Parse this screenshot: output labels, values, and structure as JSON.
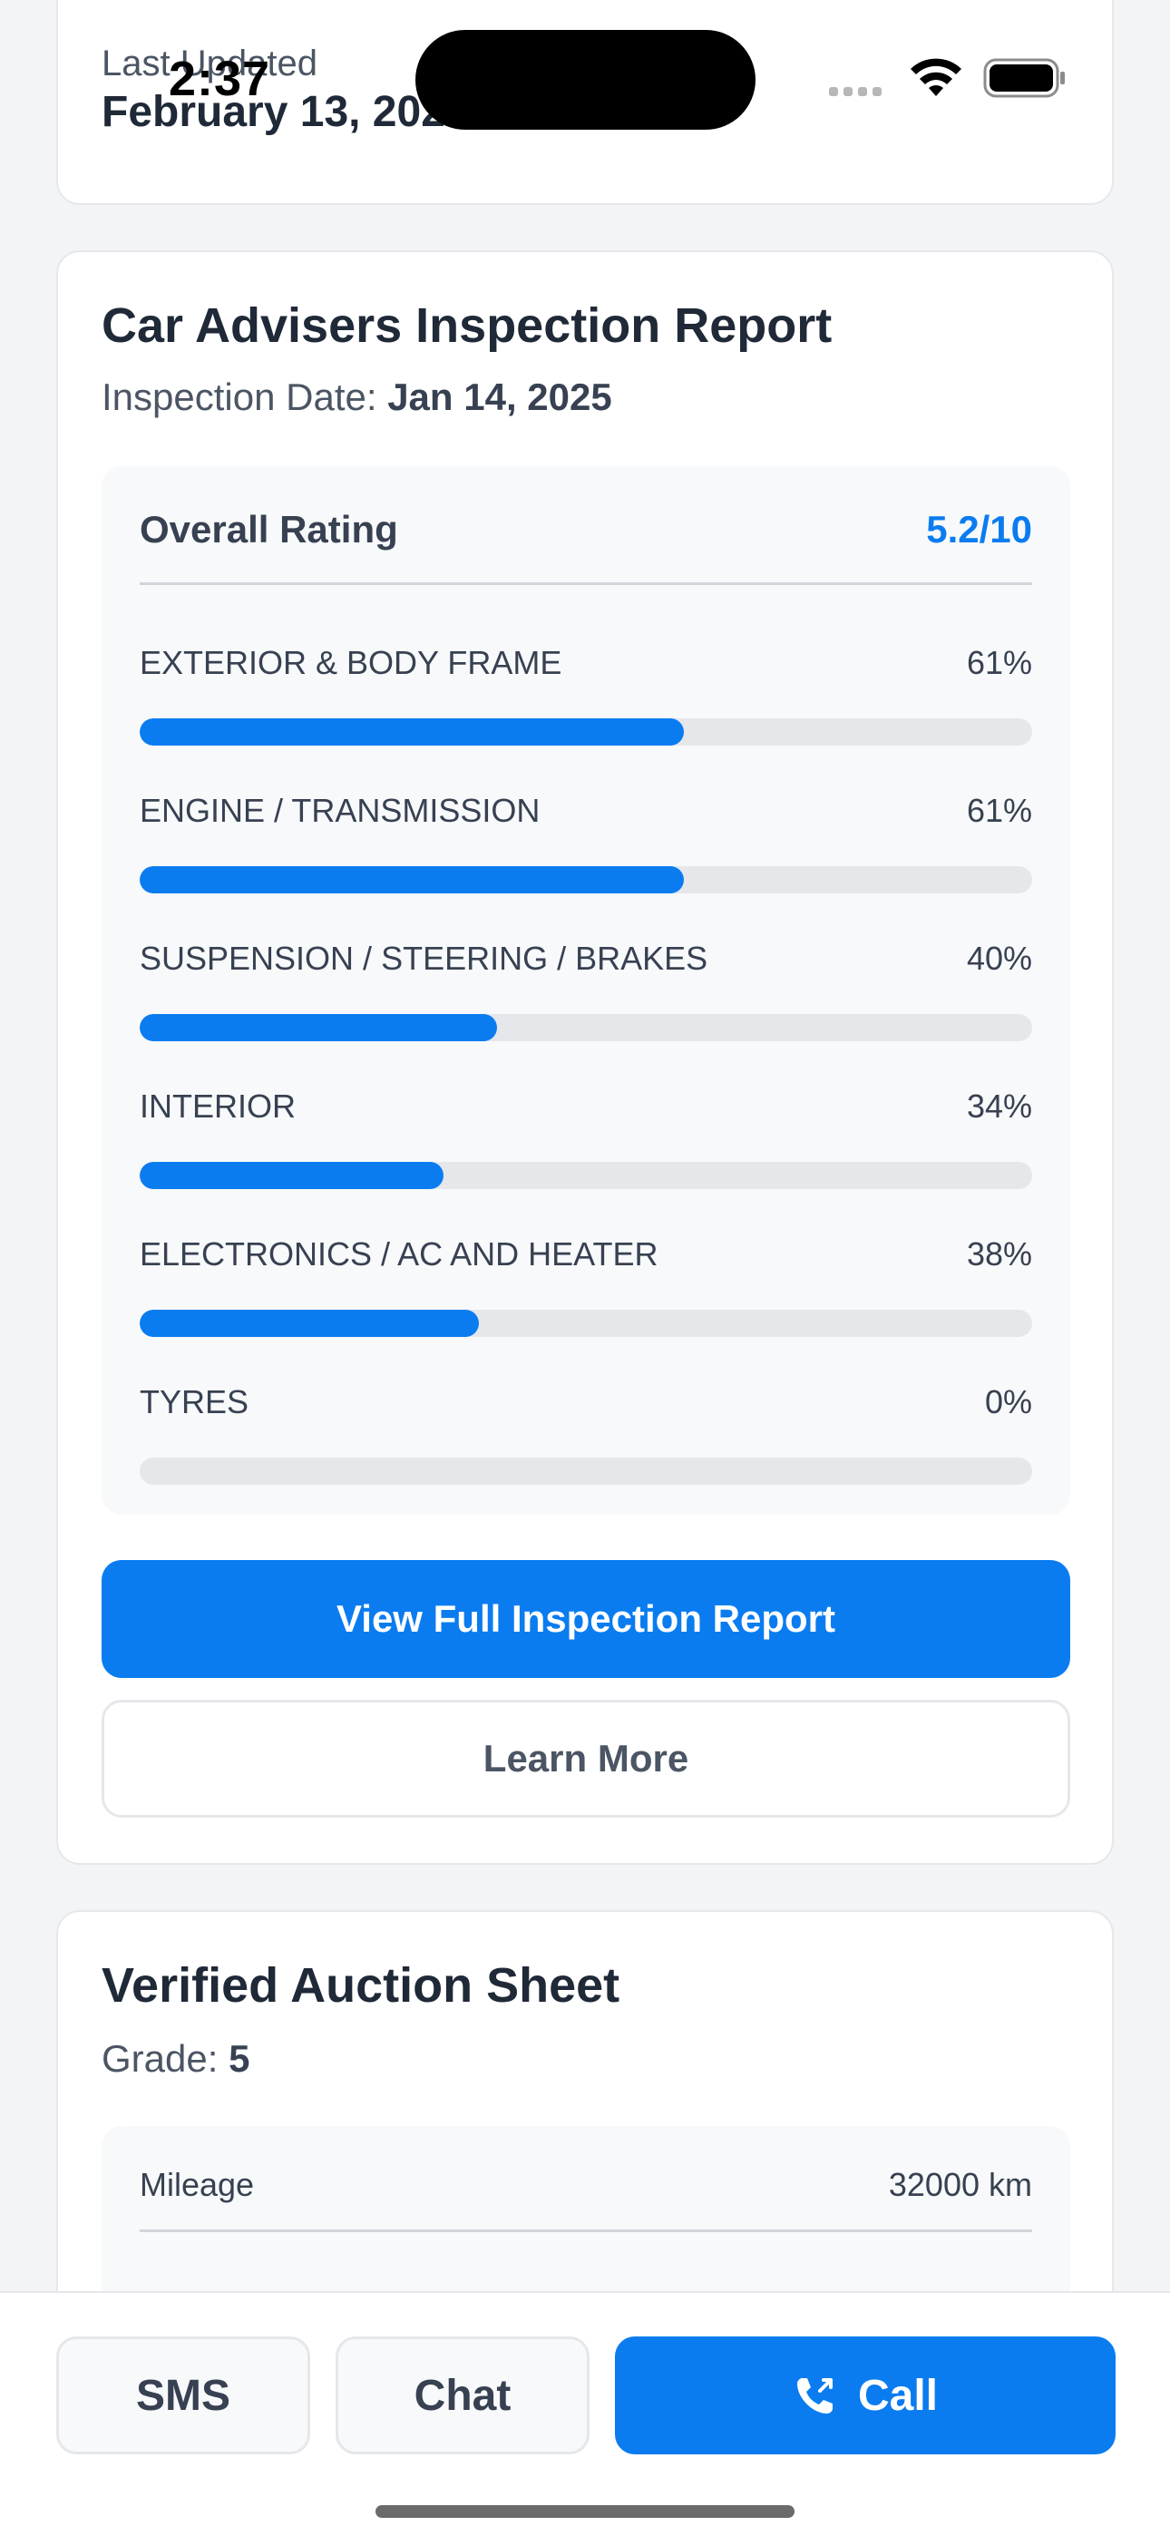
{
  "status_bar": {
    "time": "2:37"
  },
  "last_updated": {
    "label": "Last Updated",
    "date": "February 13, 2025"
  },
  "inspection": {
    "title": "Car Advisers Inspection Report",
    "date_label": "Inspection Date:",
    "date_value": "Jan 14, 2025",
    "overall_label": "Overall Rating",
    "overall_value": "5.2/10",
    "categories": [
      {
        "name": "EXTERIOR & BODY FRAME",
        "percent_label": "61%",
        "percent": 61
      },
      {
        "name": "ENGINE / TRANSMISSION",
        "percent_label": "61%",
        "percent": 61
      },
      {
        "name": "SUSPENSION / STEERING / BRAKES",
        "percent_label": "40%",
        "percent": 40
      },
      {
        "name": "INTERIOR",
        "percent_label": "34%",
        "percent": 34
      },
      {
        "name": "ELECTRONICS / AC AND HEATER",
        "percent_label": "38%",
        "percent": 38
      },
      {
        "name": "TYRES",
        "percent_label": "0%",
        "percent": 0
      }
    ],
    "view_report_label": "View Full Inspection Report",
    "learn_more_label": "Learn More"
  },
  "auction": {
    "title": "Verified Auction Sheet",
    "grade_label": "Grade:",
    "grade_value": "5",
    "rows": [
      {
        "label": "Mileage",
        "value": "32000 km"
      }
    ]
  },
  "actions": {
    "sms_label": "SMS",
    "chat_label": "Chat",
    "call_label": "Call"
  },
  "colors": {
    "accent": "#0a7cf0",
    "track": "#e5e7eb",
    "card_bg": "#ffffff",
    "page_bg": "#f3f4f6"
  },
  "icons": {
    "call": "phone-icon",
    "wifi": "wifi-icon",
    "battery": "battery-icon",
    "signal": "signal-icon"
  }
}
